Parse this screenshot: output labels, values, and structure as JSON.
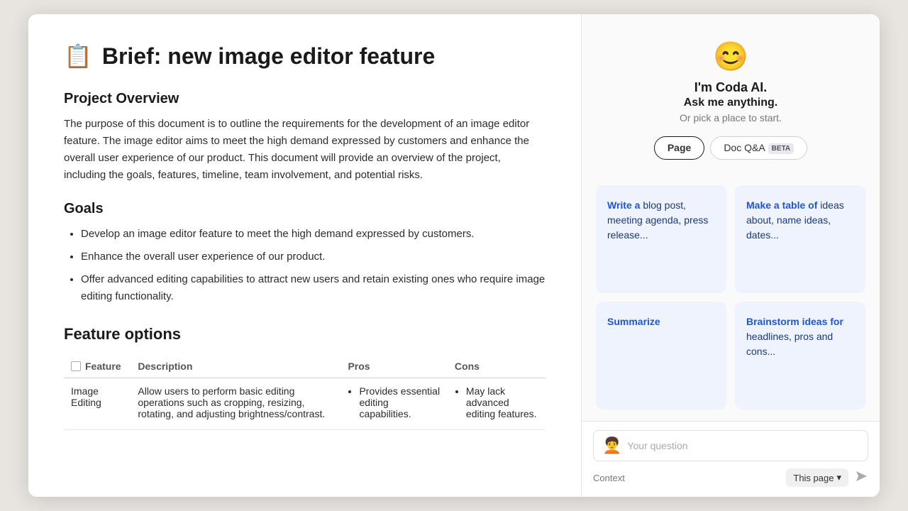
{
  "doc": {
    "icon": "📋",
    "title": "Brief: new image editor feature",
    "sections": {
      "project_overview": {
        "heading": "Project Overview",
        "text": "The purpose of this document is to outline the requirements for the development of an image editor feature. The image editor aims to meet the high demand expressed by customers and enhance the overall user experience of our product. This document will provide an overview of the project, including the goals, features, timeline, team involvement, and potential risks."
      },
      "goals": {
        "heading": "Goals",
        "items": [
          "Develop an image editor feature to meet the high demand expressed by customers.",
          "Enhance the overall user experience of our product.",
          "Offer advanced editing capabilities to attract new users and retain existing ones who require image editing functionality."
        ]
      },
      "feature_options": {
        "heading": "Feature options",
        "table": {
          "columns": [
            "Feature",
            "Description",
            "Pros",
            "Cons"
          ],
          "rows": [
            {
              "feature": "Image Editing",
              "description": "Allow users to perform basic editing operations such as cropping, resizing, rotating, and adjusting brightness/contrast.",
              "pros": [
                "Provides essential editing capabilities."
              ],
              "cons": [
                "May lack advanced editing features."
              ]
            }
          ]
        }
      }
    }
  },
  "ai_panel": {
    "avatar": "😊",
    "title": "I'm Coda AI.",
    "subtitle": "Ask me anything.",
    "prompt": "Or pick a place to start.",
    "tabs": [
      {
        "label": "Page",
        "active": true
      },
      {
        "label": "Doc Q&A",
        "badge": "BETA",
        "active": false
      }
    ],
    "suggestions": [
      {
        "keyword": "Write a",
        "rest": " blog post, meeting agenda, press release..."
      },
      {
        "keyword": "Make a table of",
        "rest": " ideas about, name ideas, dates..."
      },
      {
        "keyword": "Summarize",
        "rest": ""
      },
      {
        "keyword": "Brainstorm ideas for",
        "rest": " headlines, pros and cons..."
      }
    ],
    "input": {
      "placeholder": "Your question",
      "value": ""
    },
    "context": {
      "label": "Context",
      "option": "This page"
    },
    "send_button_label": "➤"
  }
}
